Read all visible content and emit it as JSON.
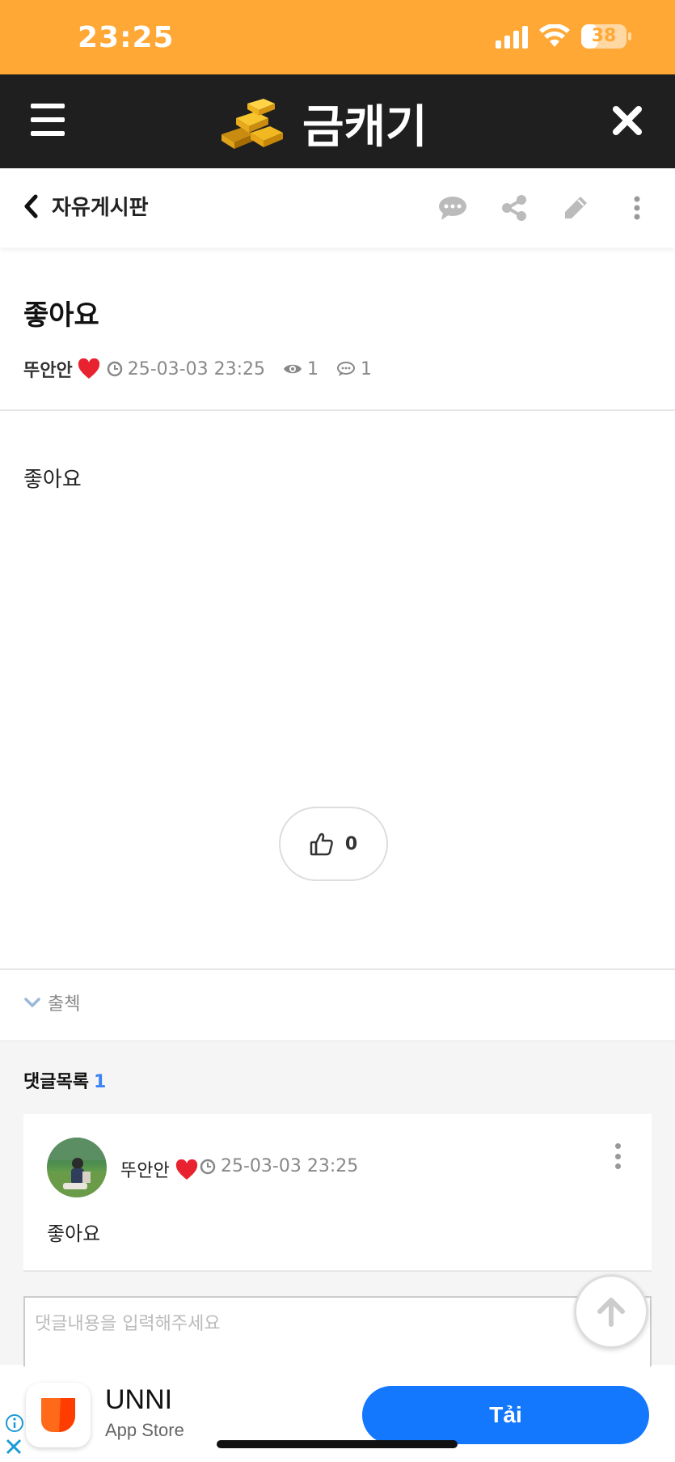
{
  "status_bar": {
    "time": "23:25",
    "battery_level": 38,
    "battery_text": "38"
  },
  "header": {
    "logo_icon": "gold-bars-icon",
    "title": "금캐기",
    "menu_icon": "hamburger-icon",
    "close_icon": "close-icon"
  },
  "board_bar": {
    "back_label": "자유게시판",
    "tools": [
      "comment-icon",
      "share-icon",
      "pencil-icon",
      "more-vertical-icon"
    ]
  },
  "post": {
    "title": "좋아요",
    "author": "뚜안안",
    "author_badge_icon": "heart-icon",
    "date": "25-03-03 23:25",
    "views": "1",
    "comments": "1",
    "body": "좋아요",
    "likes": "0",
    "tag": "출첵"
  },
  "comments": {
    "heading": "댓글목록",
    "count": "1",
    "items": [
      {
        "author": "뚜안안",
        "date": "25-03-03 23:25",
        "text": "좋아요"
      }
    ],
    "input_placeholder": "댓글내용을 입력해주세요"
  },
  "ad": {
    "app_name": "UNNI",
    "store": "App Store",
    "cta": "Tải"
  },
  "colors": {
    "status_bar": "#FFA836",
    "header": "#1f1f1f",
    "accent_blue": "#3b82f6",
    "cta_blue": "#1478ff"
  }
}
